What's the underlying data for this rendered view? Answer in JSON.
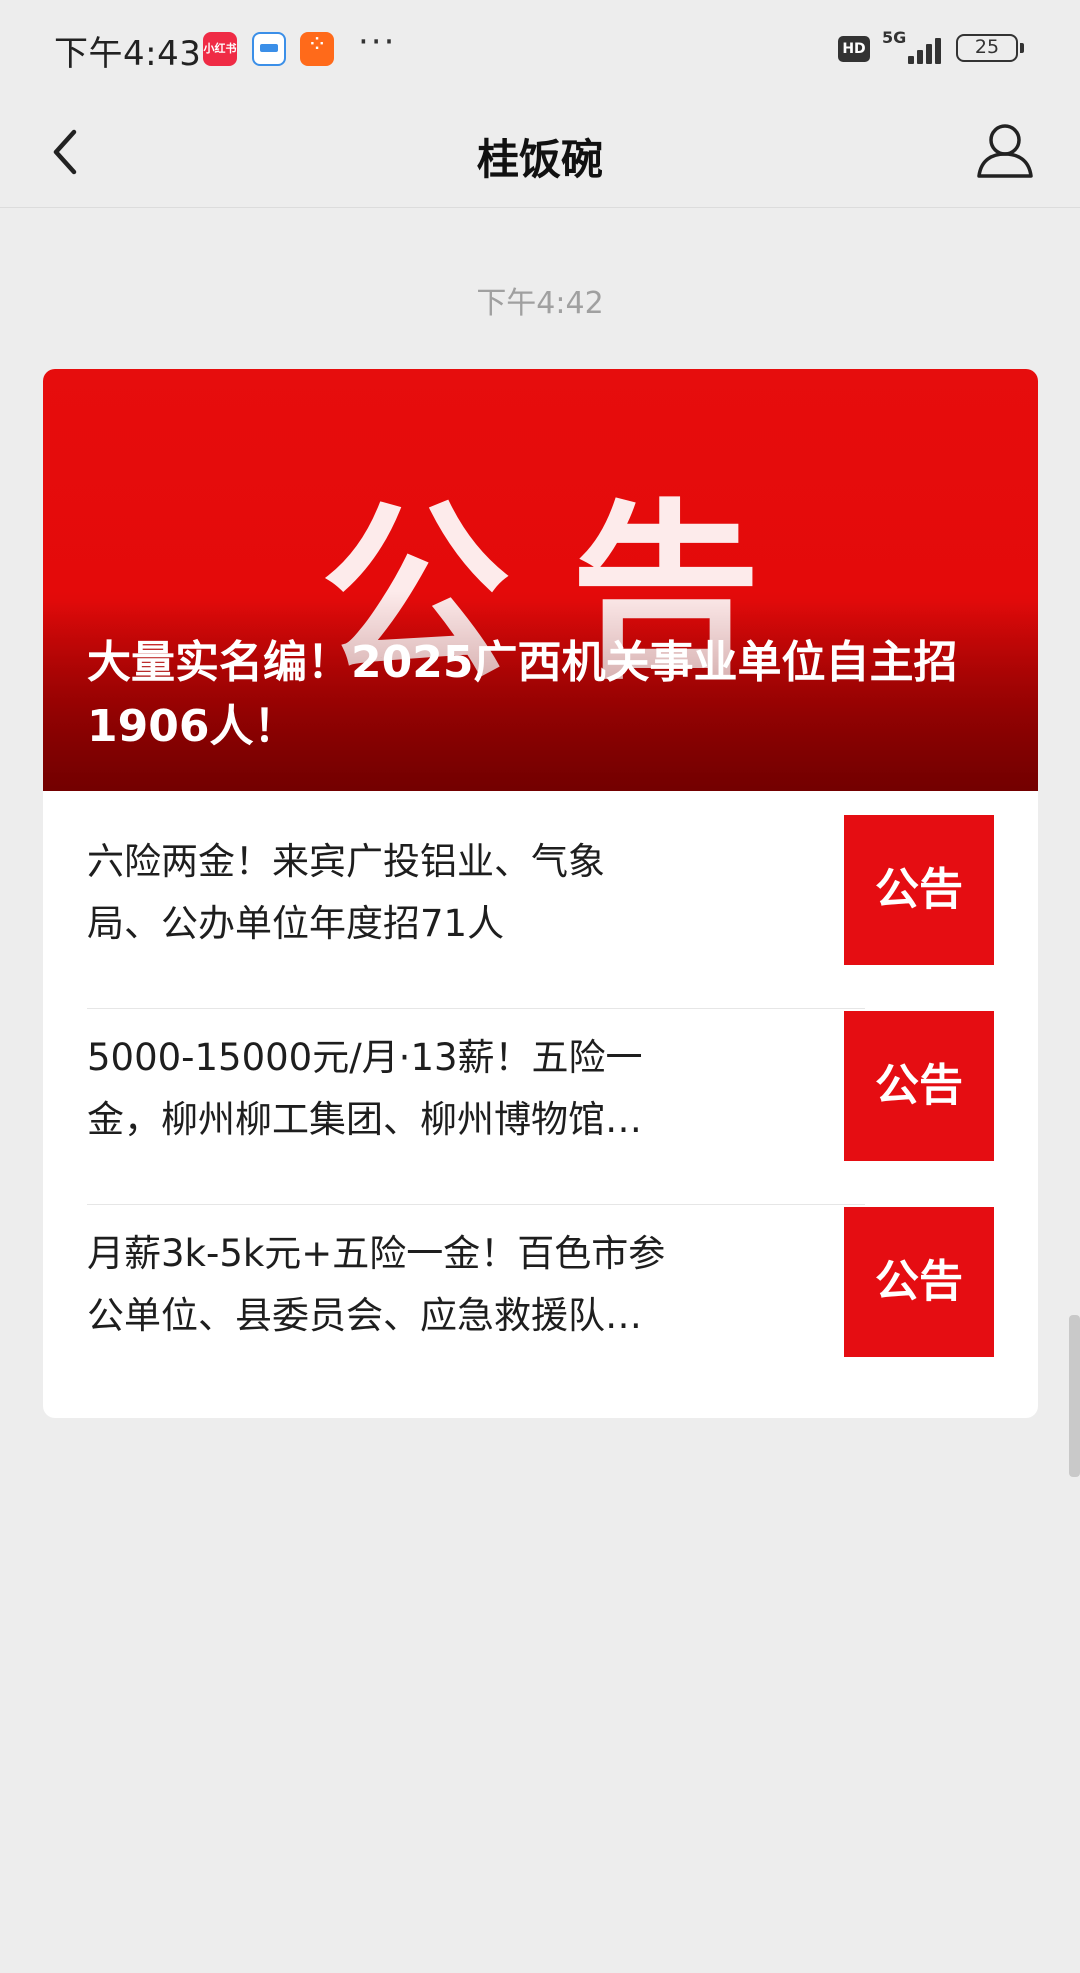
{
  "status_bar": {
    "time": "下午4:43",
    "notif_app_1_text": "小红书",
    "more": "···",
    "hd": "HD",
    "network": "5G",
    "battery": "25"
  },
  "nav": {
    "title": "桂饭碗"
  },
  "chat": {
    "timestamp": "下午4:42"
  },
  "article_card": {
    "hero": {
      "watermark": "公告",
      "title": "大量实名编！2025广西机关事业单位自主招1906人！"
    },
    "items": [
      {
        "text": "六险两金！来宾广投铝业、气象局、公办单位年度招71人",
        "thumb": "公告"
      },
      {
        "text": "5000-15000元/月·13薪！五险一金，柳州柳工集团、柳州博物馆、十一冶…",
        "thumb": "公告"
      },
      {
        "text": "月薪3k-5k元+五险一金！百色市参公单位、县委员会、应急救援队、医疗集…",
        "thumb": "公告"
      }
    ]
  },
  "colors": {
    "background": "#ededed",
    "accent_red": "#e50d12",
    "card": "#ffffff"
  }
}
